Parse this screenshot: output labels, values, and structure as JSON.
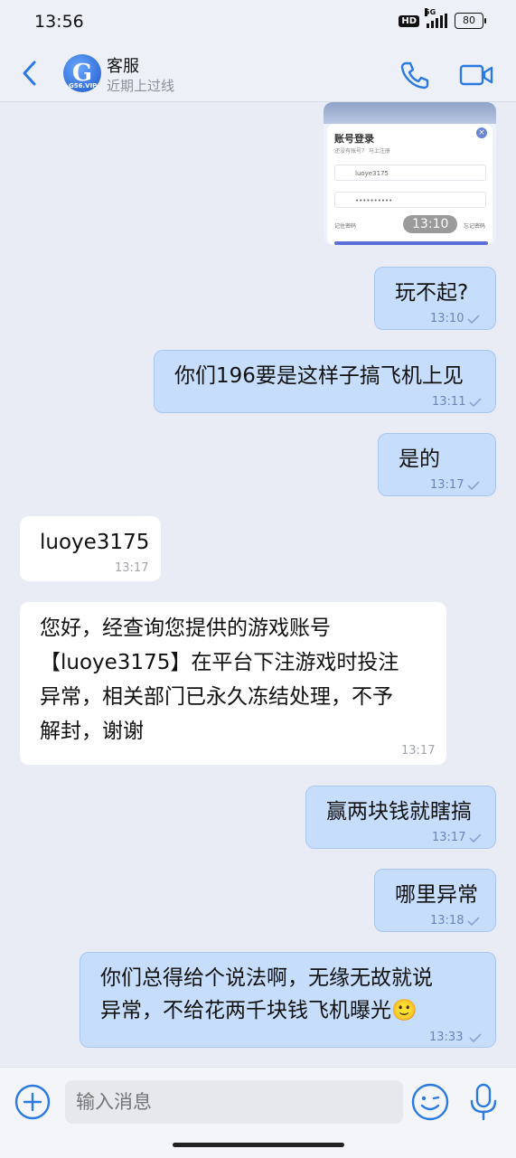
{
  "status_bar": {
    "time": "13:56",
    "hd": "HD",
    "network": "5G",
    "battery": "80"
  },
  "header": {
    "title": "客服",
    "subtitle": "近期上过线",
    "avatar_text": "G",
    "avatar_sub": "G56.VIP"
  },
  "image_message": {
    "login_title": "账号登录",
    "login_subtitle": "还没有账号？ 马上注册",
    "username": "luoye3175",
    "password": "••••••••••",
    "remember": "记住密码",
    "forgot": "忘记密码",
    "time": "13:10"
  },
  "messages": [
    {
      "direction": "out",
      "text": "玩不起?",
      "time": "13:10"
    },
    {
      "direction": "out",
      "text": "你们196要是这样子搞飞机上见",
      "time": "13:11"
    },
    {
      "direction": "out",
      "text": "是的",
      "time": "13:17"
    },
    {
      "direction": "in",
      "text": "luoye3175",
      "time": "13:17"
    },
    {
      "direction": "in",
      "lines": [
        "您好，经查询您提供的游戏账号",
        "【luoye3175】在平台下注游戏时投注",
        "异常，相关部门已永久冻结处理，不予",
        "解封，谢谢"
      ],
      "time": "13:17"
    },
    {
      "direction": "out",
      "text": "赢两块钱就瞎搞",
      "time": "13:17"
    },
    {
      "direction": "out",
      "text": "哪里异常",
      "time": "13:18"
    },
    {
      "direction": "out",
      "lines": [
        "你们总得给个说法啊，无缘无故就说",
        "异常，不给花两千块钱飞机曝光🙂"
      ],
      "time": "13:33"
    }
  ],
  "input": {
    "placeholder": "输入消息"
  },
  "colors": {
    "outgoing_bubble": "#c7ddfc",
    "incoming_bubble": "#ffffff",
    "accent": "#2a7ae2",
    "background": "#e9ecf5"
  }
}
